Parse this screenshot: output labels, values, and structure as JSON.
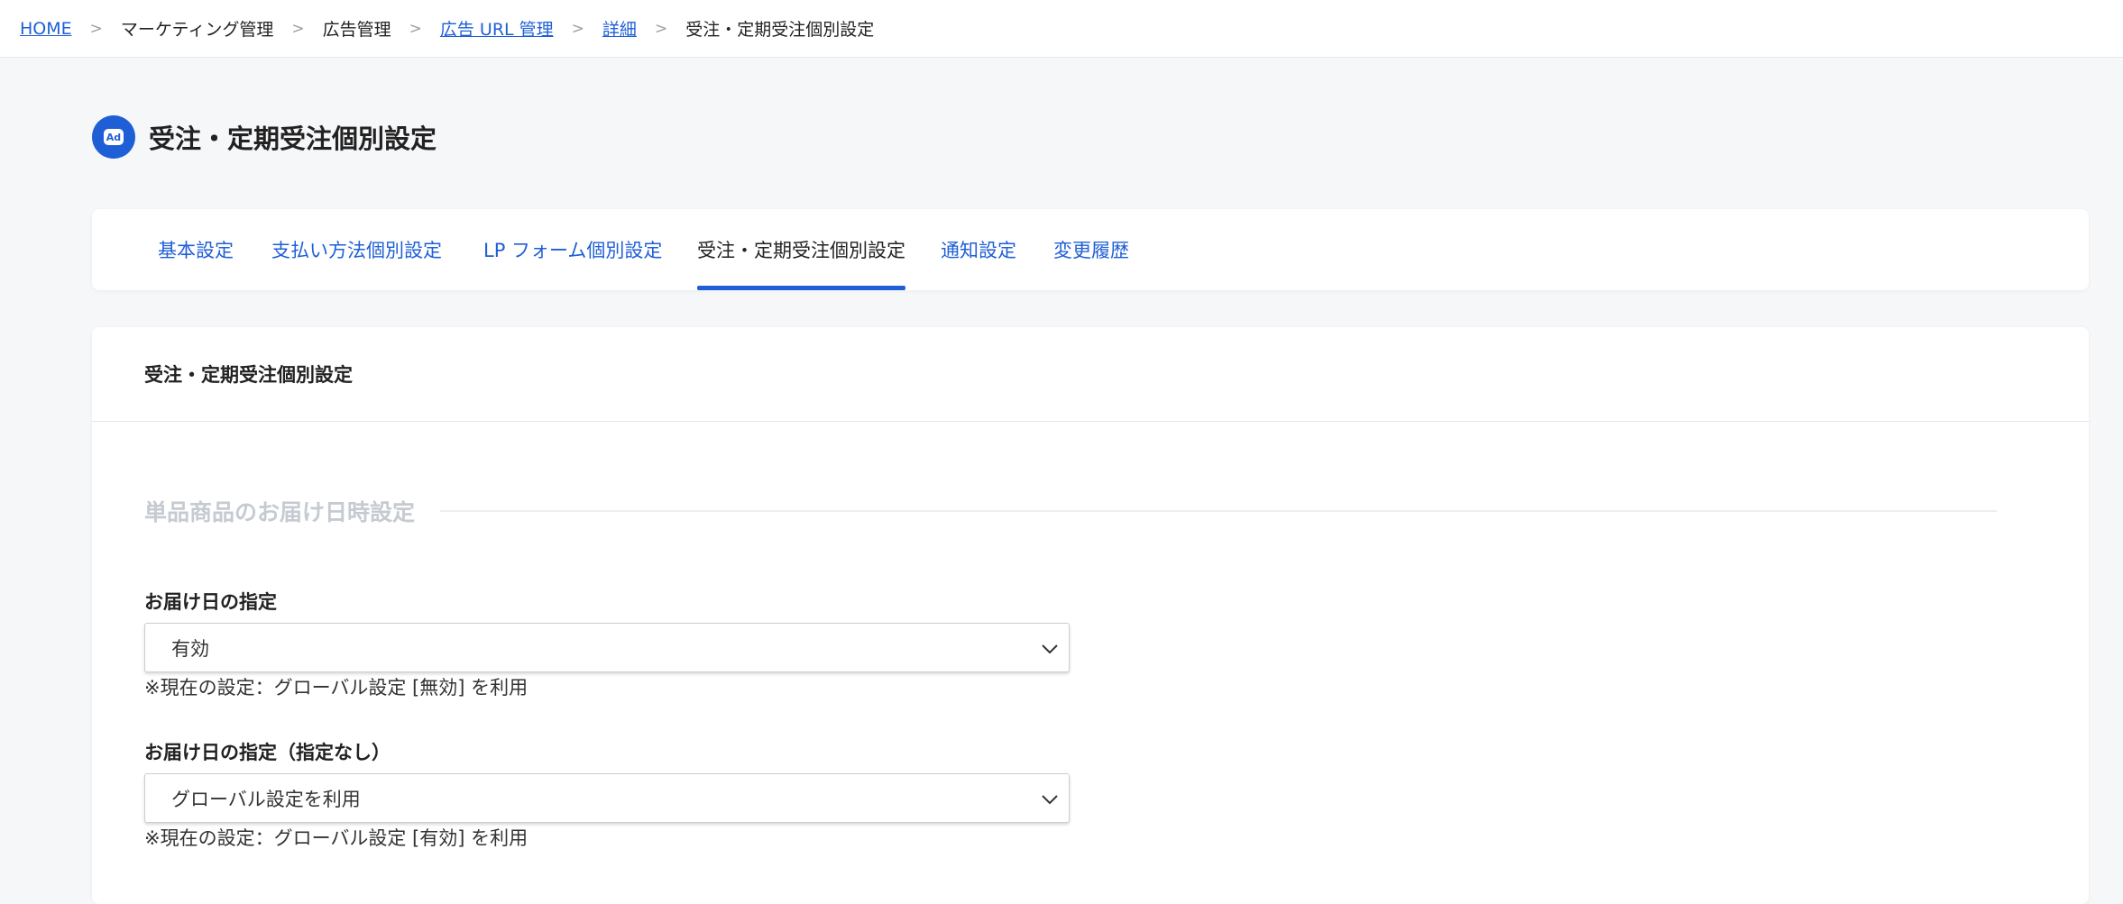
{
  "breadcrumb": {
    "home": "HOME",
    "marketing": "マーケティング管理",
    "ad_management": "広告管理",
    "ad_url": "広告 URL 管理",
    "detail": "詳細",
    "current": "受注・定期受注個別設定",
    "separator": ">"
  },
  "page": {
    "title": "受注・定期受注個別設定",
    "icon_label": "Ad"
  },
  "tabs": [
    {
      "label": "基本設定",
      "active": false
    },
    {
      "label": "支払い方法個別設定",
      "active": false
    },
    {
      "label": "LP フォーム個別設定",
      "active": false
    },
    {
      "label": "受注・定期受注個別設定",
      "active": true
    },
    {
      "label": "通知設定",
      "active": false
    },
    {
      "label": "変更履歴",
      "active": false
    }
  ],
  "card": {
    "heading": "受注・定期受注個別設定",
    "section_title": "単品商品のお届け日時設定",
    "fields": [
      {
        "label": "お届け日の指定",
        "value": "有効",
        "note": "※現在の設定：グローバル設定 [無効] を利用"
      },
      {
        "label": "お届け日の指定（指定なし）",
        "value": "グローバル設定を利用",
        "note": "※現在の設定：グローバル設定 [有効] を利用"
      }
    ]
  },
  "colors": {
    "accent": "#1f5fd6",
    "background": "#f6f7f9",
    "muted_heading": "#c6cbd2"
  }
}
